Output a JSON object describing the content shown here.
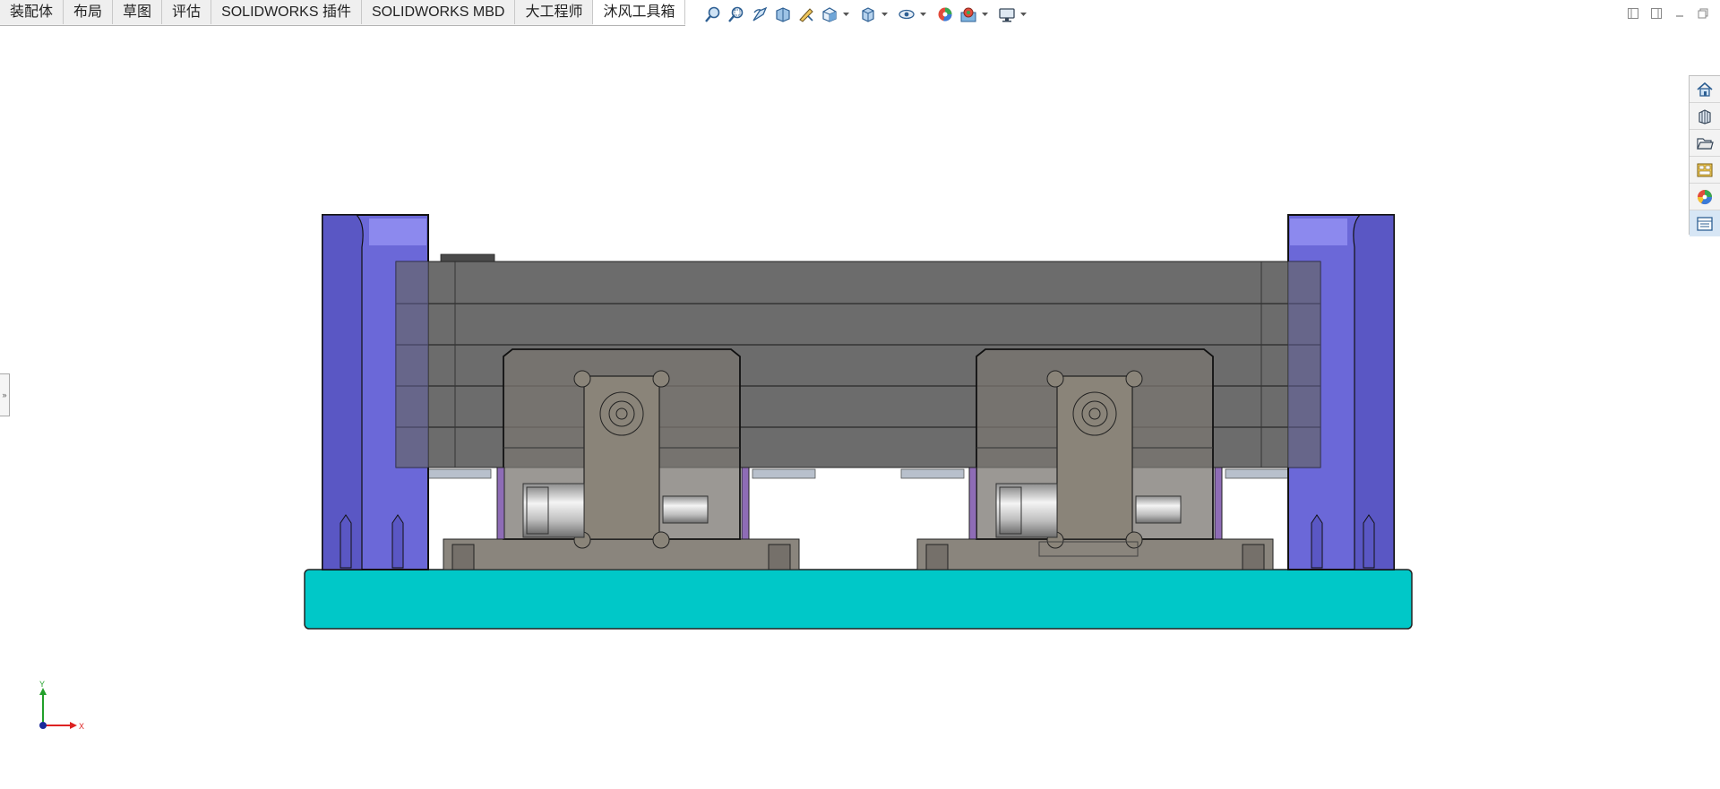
{
  "tabs": [
    {
      "label": "装配体"
    },
    {
      "label": "布局"
    },
    {
      "label": "草图"
    },
    {
      "label": "评估"
    },
    {
      "label": "SOLIDWORKS 插件"
    },
    {
      "label": "SOLIDWORKS MBD"
    },
    {
      "label": "大工程师"
    },
    {
      "label": "沐风工具箱",
      "active": true
    }
  ],
  "hud_toolbar": [
    {
      "icon": "zoom-to-fit-icon"
    },
    {
      "icon": "zoom-to-area-icon"
    },
    {
      "icon": "previous-view-icon"
    },
    {
      "icon": "section-view-icon"
    },
    {
      "icon": "dynamic-annotation-icon"
    },
    {
      "icon": "view-orientation-icon",
      "dropdown": true
    },
    {
      "icon": "display-style-icon",
      "dropdown": true
    },
    {
      "icon": "hide-show-items-icon",
      "dropdown": true
    },
    {
      "icon": "edit-appearance-icon"
    },
    {
      "icon": "apply-scene-icon",
      "dropdown": true
    },
    {
      "icon": "view-settings-icon",
      "dropdown": true
    }
  ],
  "window_controls": [
    {
      "icon": "tile-left-icon"
    },
    {
      "icon": "tile-right-icon"
    },
    {
      "icon": "minimize-icon"
    },
    {
      "icon": "restore-icon"
    }
  ],
  "task_pane": [
    {
      "icon": "solidworks-resources-icon"
    },
    {
      "icon": "design-library-icon"
    },
    {
      "icon": "file-explorer-icon"
    },
    {
      "icon": "view-palette-icon"
    },
    {
      "icon": "appearances-scenes-icon"
    },
    {
      "icon": "custom-properties-icon"
    }
  ],
  "left_panel_handle": "»",
  "triad": {
    "x_label": "X",
    "y_label": "Y"
  },
  "colors": {
    "base_plate": "#00c8c8",
    "side_posts": "#6b68d8",
    "main_block": "#5f5f5f",
    "carriage": "#7a7670",
    "selection_blue": "#d7e6f5"
  }
}
